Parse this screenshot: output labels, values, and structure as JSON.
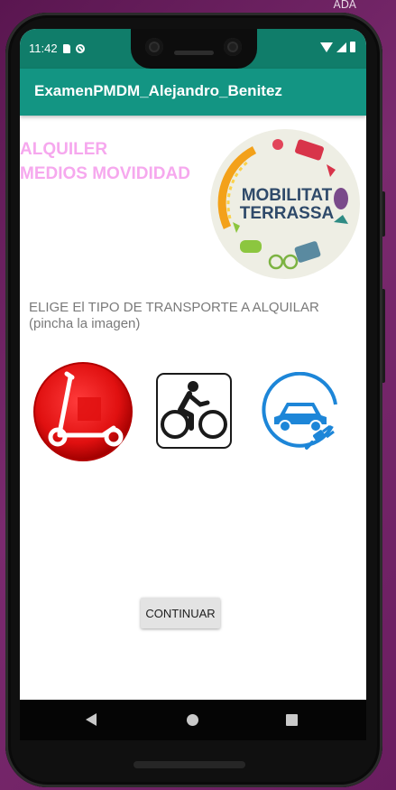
{
  "host": {
    "label": "ADA"
  },
  "status_bar": {
    "time": "11:42"
  },
  "app_bar": {
    "title": "ExamenPMDM_Alejandro_Benitez"
  },
  "content": {
    "heading_line1": "ALQUILER",
    "heading_line2": "MEDIOS MOVIDIDAD",
    "logo_text_line1": "MOBILITAT",
    "logo_text_line2": "TERRASSA",
    "instruction_line1": "ELIGE El TIPO DE TRANSPORTE A ALQUILAR",
    "instruction_line2": "(pincha la imagen)",
    "options": [
      {
        "icon": "electric-scooter-icon",
        "color": "#e01010"
      },
      {
        "icon": "bicycle-icon",
        "color": "#1a1a1a"
      },
      {
        "icon": "electric-car-icon",
        "color": "#1d86d8"
      }
    ],
    "continue_label": "CONTINUAR"
  },
  "colors": {
    "status_bar": "#107d6a",
    "app_bar": "#139583",
    "heading": "#f6a8ee",
    "logo_text": "#2f4a6a"
  }
}
